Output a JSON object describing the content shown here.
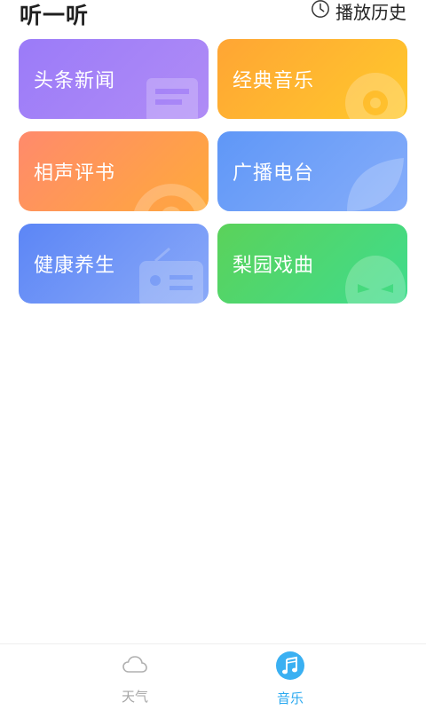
{
  "header": {
    "title": "听一听",
    "history_label": "播放历史",
    "history_icon": "clock-icon"
  },
  "categories": [
    {
      "label": "头条新闻",
      "icon": "newspaper-icon",
      "gradient": [
        "#9b7bf8",
        "#b08cf6"
      ]
    },
    {
      "label": "经典音乐",
      "icon": "record-icon",
      "gradient": [
        "#ffa534",
        "#ffc92c"
      ]
    },
    {
      "label": "相声评书",
      "icon": "fan-icon",
      "gradient": [
        "#ff8a6c",
        "#ffaa3a"
      ]
    },
    {
      "label": "广播电台",
      "icon": "leaf-icon",
      "gradient": [
        "#5f97f7",
        "#86adfa"
      ]
    },
    {
      "label": "健康养生",
      "icon": "radio-icon",
      "gradient": [
        "#5c86f6",
        "#8aa9f8"
      ]
    },
    {
      "label": "梨园戏曲",
      "icon": "opera-mask-icon",
      "gradient": [
        "#5bd25a",
        "#3fdc8d"
      ]
    }
  ],
  "tabbar": {
    "tabs": [
      {
        "label": "天气",
        "icon": "cloud-icon",
        "active": false
      },
      {
        "label": "音乐",
        "icon": "music-note-icon",
        "active": true
      }
    ],
    "active_color": "#2aa9f0",
    "inactive_color": "#a6a6a6"
  }
}
